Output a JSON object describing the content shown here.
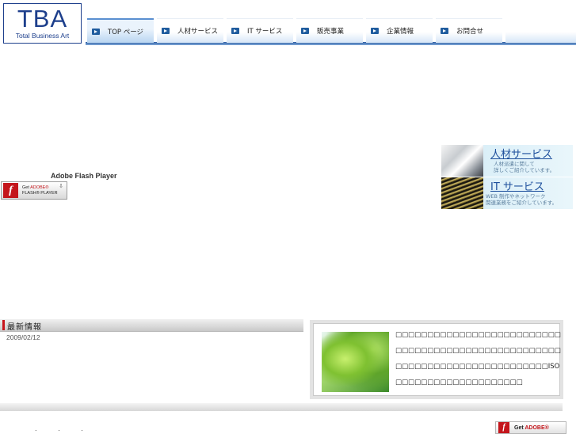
{
  "logo": {
    "mark": "TBA",
    "sub": "Total Business Art"
  },
  "nav": {
    "items": [
      {
        "label": "TOP ページ"
      },
      {
        "label": "人材サービス"
      },
      {
        "label": "IT サービス"
      },
      {
        "label": "販売事業"
      },
      {
        "label": "企業情報"
      },
      {
        "label": "お問合せ"
      }
    ]
  },
  "flash": {
    "title": "Adobe Flash Player",
    "badge_line1_prefix": "Get ",
    "badge_line1_brand": "ADOBE®",
    "badge_line2": "FLASH® PLAYER"
  },
  "banners": [
    {
      "title": "人材サービス",
      "desc1": "人材派遣に関して",
      "desc2": "詳しくご紹介しています。"
    },
    {
      "title": "IT サービス",
      "desc1": "WEB 制作やネットワーク",
      "desc2": "関連業務をご紹介しています。"
    }
  ],
  "news": {
    "heading": "最新情報",
    "date": "2009/02/12"
  },
  "info": {
    "text": "□□□□□□□□□□□□□□□□□□□□□□□□□□□□□□□□□□□□□□□□□□□□□□□□□□□□□□□□□□□□□□□□□□□□□□□□□□□□ISO□□□□□□□□□□□□□□□□□□□□"
  },
  "footer": {
    "dots": ". . .",
    "badge_prefix": "Get ",
    "badge_brand": "ADOBE®"
  }
}
